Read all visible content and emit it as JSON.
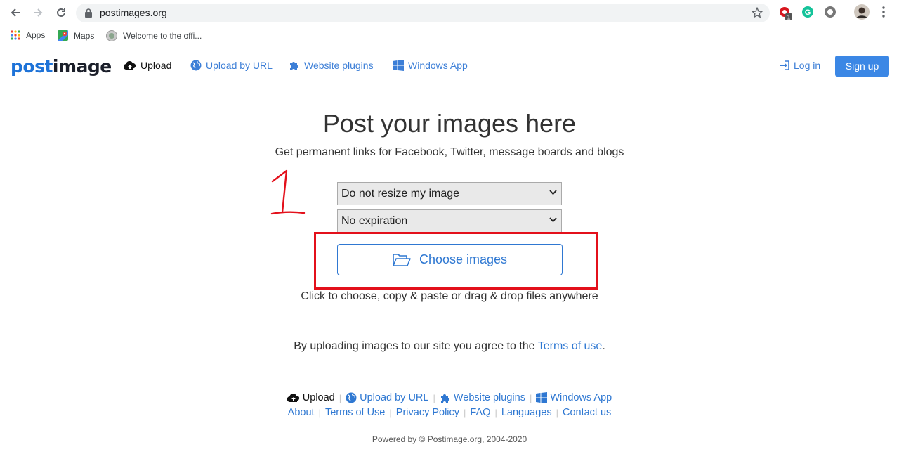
{
  "browser": {
    "url": "postimages.org",
    "bookmarks": [
      {
        "label": "Apps",
        "icon": "apps-grid-icon"
      },
      {
        "label": "Maps",
        "icon": "maps-icon"
      },
      {
        "label": "Welcome to the offi...",
        "icon": "globe-icon"
      }
    ],
    "extension_badge": "1"
  },
  "site": {
    "logo_post": "post",
    "logo_image": "image",
    "nav": {
      "upload": "Upload",
      "upload_by_url": "Upload by URL",
      "website_plugins": "Website plugins",
      "windows_app": "Windows App"
    },
    "login": "Log in",
    "signup": "Sign up"
  },
  "main": {
    "title": "Post your images here",
    "subtitle": "Get permanent links for Facebook, Twitter, message boards and blogs",
    "resize_select": "Do not resize my image",
    "expiration_select": "No expiration",
    "choose_button": "Choose images",
    "hint": "Click to choose, copy & paste or drag & drop files anywhere",
    "terms_prefix": "By uploading images to our site you agree to the ",
    "terms_link": "Terms of use",
    "terms_suffix": ".",
    "annotation_number": "1"
  },
  "footer": {
    "row1": {
      "upload": "Upload",
      "upload_by_url": "Upload by URL",
      "website_plugins": "Website plugins",
      "windows_app": "Windows App"
    },
    "row2": {
      "about": "About",
      "terms": "Terms of Use",
      "privacy": "Privacy Policy",
      "faq": "FAQ",
      "languages": "Languages",
      "contact": "Contact us"
    },
    "powered": "Powered by © Postimage.org, 2004-2020"
  },
  "colors": {
    "link": "#2f78d2",
    "signup_bg": "#3b87e5",
    "annotation_red": "#e3101b"
  }
}
